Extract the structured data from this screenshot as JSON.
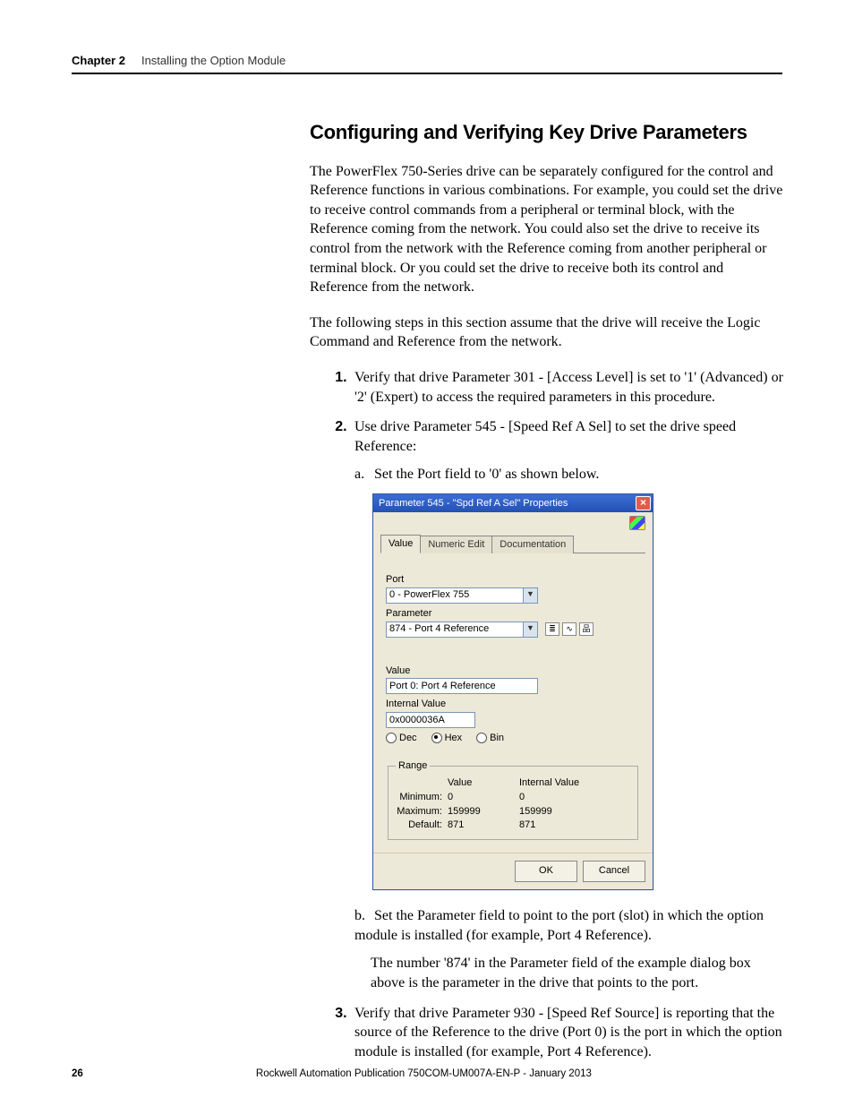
{
  "header": {
    "chapter": "Chapter 2",
    "title": "Installing the Option Module"
  },
  "section_heading": "Configuring and Verifying Key Drive Parameters",
  "para1": "The PowerFlex 750-Series drive can be separately configured for the control and Reference functions in various combinations. For example, you could set the drive to receive control commands from a peripheral or terminal block, with the Reference coming from the network. You could also set the drive to receive its control from the network with the Reference coming from another peripheral or terminal block. Or you could set the drive to receive both its control and Reference from the network.",
  "para2": "The following steps in this section assume that the drive will receive the Logic Command and Reference from the network.",
  "steps": {
    "s1": "Verify that drive Parameter 301 - [Access Level] is set to '1' (Advanced) or '2' (Expert) to access the required parameters in this procedure.",
    "s2": "Use drive Parameter 545 - [Speed Ref A Sel] to set the drive speed Reference:",
    "s2a_prefix": "a.",
    "s2a": "Set the Port field to '0' as shown below.",
    "s2b_prefix": "b.",
    "s2b": "Set the Parameter field to point to the port (slot) in which the option module is installed (for example, Port 4 Reference).",
    "s2b_note": "The number '874' in the Parameter field of the example dialog box above is the parameter in the drive that points to the port.",
    "s3": "Verify that drive Parameter 930 - [Speed Ref Source] is reporting that the source of the Reference to the drive (Port 0) is the port in which the option module is installed (for example, Port 4 Reference)."
  },
  "dialog": {
    "title": "Parameter 545 - \"Spd Ref A Sel\" Properties",
    "tabs": {
      "t1": "Value",
      "t2": "Numeric Edit",
      "t3": "Documentation"
    },
    "labels": {
      "port": "Port",
      "parameter": "Parameter",
      "value": "Value",
      "internal_value": "Internal Value"
    },
    "port_value": "0 - PowerFlex 755",
    "param_value": "874 - Port 4 Reference",
    "value_field": "Port 0: Port 4 Reference",
    "internal_value_field": "0x0000036A",
    "radix": {
      "dec": "Dec",
      "hex": "Hex",
      "bin": "Bin"
    },
    "range": {
      "legend": "Range",
      "col_value": "Value",
      "col_internal": "Internal Value",
      "min_label": "Minimum:",
      "max_label": "Maximum:",
      "def_label": "Default:",
      "min_v": "0",
      "min_iv": "0",
      "max_v": "159999",
      "max_iv": "159999",
      "def_v": "871",
      "def_iv": "871"
    },
    "ok": "OK",
    "cancel": "Cancel"
  },
  "footer": {
    "page": "26",
    "pub": "Rockwell Automation Publication 750COM-UM007A-EN-P - January 2013"
  }
}
